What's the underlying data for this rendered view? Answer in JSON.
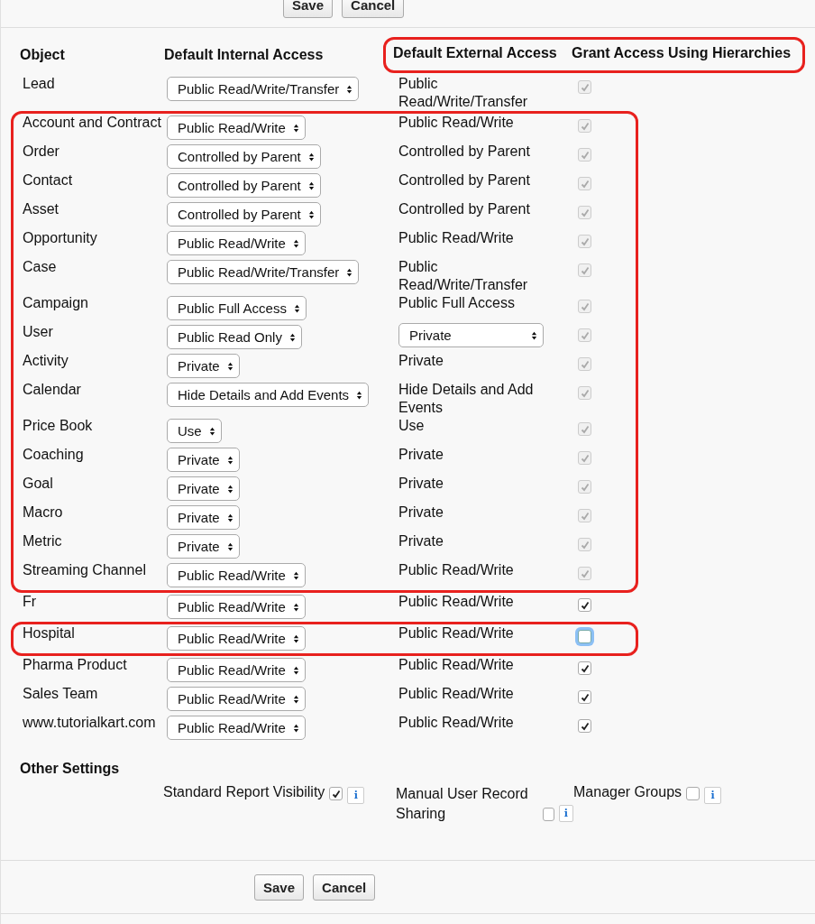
{
  "top_buttons": [
    "Save",
    "Cancel"
  ],
  "columns": [
    {
      "label": "Object",
      "highlighted": false
    },
    {
      "label": "Default Internal Access",
      "highlighted": false
    },
    {
      "label": "Default External Access",
      "highlighted": true
    },
    {
      "label": "Grant Access Using Hierarchies",
      "highlighted": true
    }
  ],
  "row_groups": [
    {
      "highlighted": false,
      "rows": [
        {
          "object": "Lead",
          "internal": "Public Read/Write/Transfer",
          "external": {
            "kind": "text",
            "value": "Public Read/Write/Transfer"
          },
          "grant": {
            "checked": true,
            "disabled": true,
            "focused": false
          }
        }
      ]
    },
    {
      "highlighted": true,
      "rows": [
        {
          "object": "Account and Contract",
          "internal": "Public Read/Write",
          "external": {
            "kind": "text",
            "value": "Public Read/Write"
          },
          "grant": {
            "checked": true,
            "disabled": true,
            "focused": false
          }
        },
        {
          "object": "Order",
          "internal": "Controlled by Parent",
          "external": {
            "kind": "text",
            "value": "Controlled by Parent"
          },
          "grant": {
            "checked": true,
            "disabled": true,
            "focused": false
          }
        },
        {
          "object": "Contact",
          "internal": "Controlled by Parent",
          "external": {
            "kind": "text",
            "value": "Controlled by Parent"
          },
          "grant": {
            "checked": true,
            "disabled": true,
            "focused": false
          }
        },
        {
          "object": "Asset",
          "internal": "Controlled by Parent",
          "external": {
            "kind": "text",
            "value": "Controlled by Parent"
          },
          "grant": {
            "checked": true,
            "disabled": true,
            "focused": false
          }
        },
        {
          "object": "Opportunity",
          "internal": "Public Read/Write",
          "external": {
            "kind": "text",
            "value": "Public Read/Write"
          },
          "grant": {
            "checked": true,
            "disabled": true,
            "focused": false
          }
        },
        {
          "object": "Case",
          "internal": "Public Read/Write/Transfer",
          "external": {
            "kind": "text",
            "value": "Public Read/Write/Transfer"
          },
          "grant": {
            "checked": true,
            "disabled": true,
            "focused": false
          }
        },
        {
          "object": "Campaign",
          "internal": "Public Full Access",
          "external": {
            "kind": "text",
            "value": "Public Full Access"
          },
          "grant": {
            "checked": true,
            "disabled": true,
            "focused": false
          }
        },
        {
          "object": "User",
          "internal": "Public Read Only",
          "external": {
            "kind": "select",
            "value": "Private"
          },
          "grant": {
            "checked": true,
            "disabled": true,
            "focused": false
          }
        },
        {
          "object": "Activity",
          "internal": "Private",
          "external": {
            "kind": "text",
            "value": "Private"
          },
          "grant": {
            "checked": true,
            "disabled": true,
            "focused": false
          }
        },
        {
          "object": "Calendar",
          "internal": "Hide Details and Add Events",
          "external": {
            "kind": "text",
            "value": "Hide Details and Add Events"
          },
          "grant": {
            "checked": true,
            "disabled": true,
            "focused": false
          }
        },
        {
          "object": "Price Book",
          "internal": "Use",
          "external": {
            "kind": "text",
            "value": "Use"
          },
          "grant": {
            "checked": true,
            "disabled": true,
            "focused": false
          }
        },
        {
          "object": "Coaching",
          "internal": "Private",
          "external": {
            "kind": "text",
            "value": "Private"
          },
          "grant": {
            "checked": true,
            "disabled": true,
            "focused": false
          }
        },
        {
          "object": "Goal",
          "internal": "Private",
          "external": {
            "kind": "text",
            "value": "Private"
          },
          "grant": {
            "checked": true,
            "disabled": true,
            "focused": false
          }
        },
        {
          "object": "Macro",
          "internal": "Private",
          "external": {
            "kind": "text",
            "value": "Private"
          },
          "grant": {
            "checked": true,
            "disabled": true,
            "focused": false
          }
        },
        {
          "object": "Metric",
          "internal": "Private",
          "external": {
            "kind": "text",
            "value": "Private"
          },
          "grant": {
            "checked": true,
            "disabled": true,
            "focused": false
          }
        },
        {
          "object": "Streaming Channel",
          "internal": "Public Read/Write",
          "external": {
            "kind": "text",
            "value": "Public Read/Write"
          },
          "grant": {
            "checked": true,
            "disabled": true,
            "focused": false
          }
        }
      ]
    },
    {
      "highlighted": false,
      "rows": [
        {
          "object": "Fr",
          "internal": "Public Read/Write",
          "external": {
            "kind": "text",
            "value": "Public Read/Write"
          },
          "grant": {
            "checked": true,
            "disabled": false,
            "focused": false
          }
        }
      ]
    },
    {
      "highlighted": true,
      "rows": [
        {
          "object": "Hospital",
          "internal": "Public Read/Write",
          "external": {
            "kind": "text",
            "value": "Public Read/Write"
          },
          "grant": {
            "checked": false,
            "disabled": false,
            "focused": true
          }
        }
      ]
    },
    {
      "highlighted": false,
      "rows": [
        {
          "object": "Pharma Product",
          "internal": "Public Read/Write",
          "external": {
            "kind": "text",
            "value": "Public Read/Write"
          },
          "grant": {
            "checked": true,
            "disabled": false,
            "focused": false
          }
        },
        {
          "object": "Sales Team",
          "internal": "Public Read/Write",
          "external": {
            "kind": "text",
            "value": "Public Read/Write"
          },
          "grant": {
            "checked": true,
            "disabled": false,
            "focused": false
          }
        },
        {
          "object": "www.tutorialkart.com",
          "internal": "Public Read/Write",
          "external": {
            "kind": "text",
            "value": "Public Read/Write"
          },
          "grant": {
            "checked": true,
            "disabled": false,
            "focused": false
          }
        }
      ]
    }
  ],
  "other_settings": {
    "title": "Other Settings",
    "items": [
      {
        "label": "Standard Report Visibility",
        "checked": true,
        "info_label": "i"
      },
      {
        "label": "Manual User Record Sharing",
        "checked": false,
        "info_label": "i"
      },
      {
        "label": "Manager Groups",
        "checked": false,
        "info_label": "i"
      }
    ]
  },
  "bottom_buttons": [
    "Save",
    "Cancel"
  ]
}
